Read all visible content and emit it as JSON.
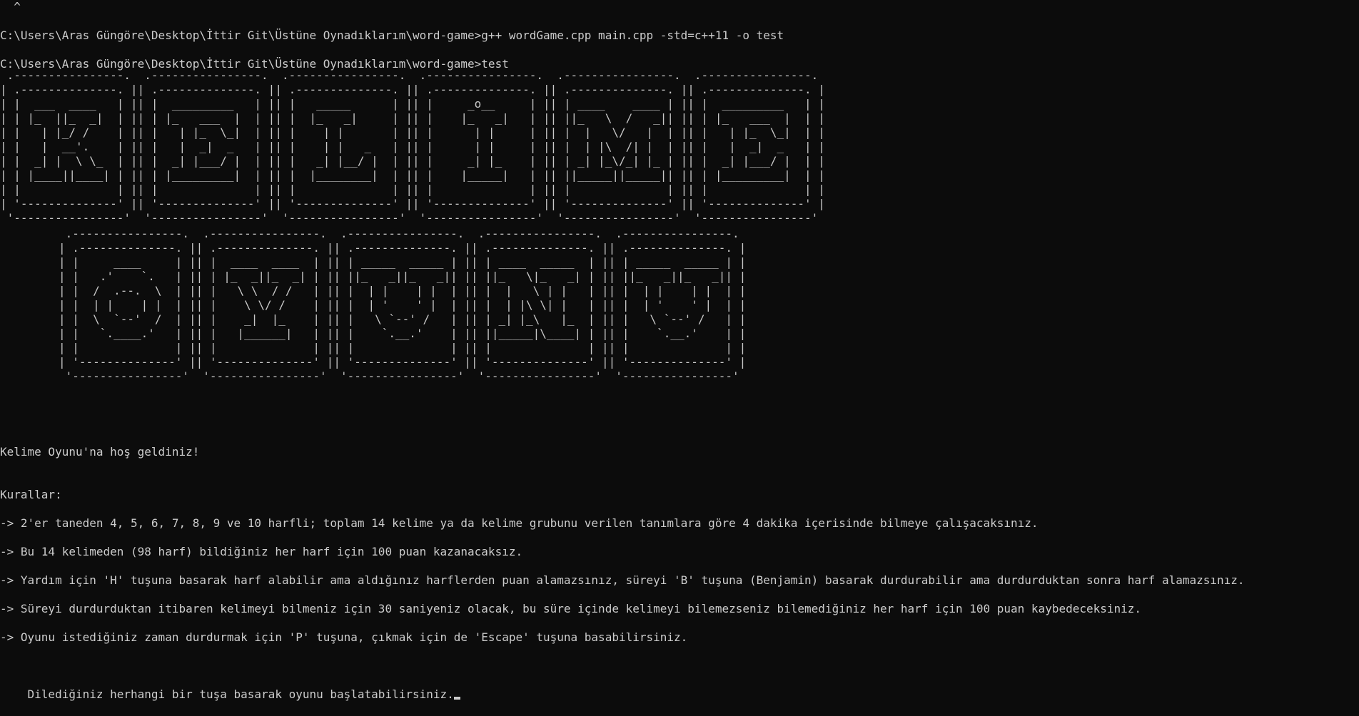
{
  "terminal": {
    "caret_line": "  ^",
    "commands": [
      "C:\\Users\\Aras Güngöre\\Desktop\\İttir Git\\Üstüne Oynadıklarım\\word-game>g++ wordGame.cpp main.cpp -std=c++11 -o test",
      "C:\\Users\\Aras Güngöre\\Desktop\\İttir Git\\Üstüne Oynadıklarım\\word-game>test"
    ],
    "banner_kelime": " .----------------.  .----------------.  .----------------.  .----------------.  .----------------.  .----------------.\n| .--------------. || .--------------. || .--------------. || .--------------. || .--------------. || .--------------. |\n| |  ___  ____   | || |  _________   | || |   _____      | || |     _o__     | || | ____    ____ | || |  _________   | |\n| | |_  ||_  _|  | || | |_   ___  |  | || |  |_   _|     | || |    |_   _|   | || ||_   \\  /   _|| || | |_   ___  |  | |\n| |   | |_/ /    | || |   | |_  \\_|  | || |    | |       | || |      | |     | || |  |   \\/   |  | || |   | |_  \\_|  | |\n| |   |  __'.    | || |   |  _|  _   | || |    | |   _   | || |      | |     | || |  | |\\  /| |  | || |   |  _|  _   | |\n| |  _| |  \\ \\_  | || |  _| |___/ |  | || |   _| |__/ |  | || |     _| |_    | || | _| |_\\/_| |_ | || |  _| |___/ |  | |\n| | |____||____| | || | |_________|  | || |  |________|  | || |    |_____|   | || ||_____||_____|| || | |_________|  | |\n| |              | || |              | || |              | || |              | || |              | || |              | |\n| '--------------' || '--------------' || '--------------' || '--------------' || '--------------' || '--------------' |\n '----------------'  '----------------'  '----------------'  '----------------'  '----------------'  '----------------'",
    "banner_oyunu": " .----------------.  .----------------.  .----------------.  .----------------.  .----------------.\n| .--------------. || .--------------. || .--------------. || .--------------. || .--------------. |\n| |     ____     | || |  ____  ____  | || | _____  _____ | || | ____  _____  | || | _____  _____ | |\n| |   .'    `.   | || | |_  _||_  _| | || ||_   _||_   _|| || ||_   \\|_   _| | || ||_   _||_   _|| |\n| |  /  .--.  \\  | || |   \\ \\  / /   | || |  | |    | |  | || |  |   \\ | |   | || |  | |    | |  | |\n| |  | |    | |  | || |    \\ \\/ /    | || |  | '    ' |  | || |  | |\\ \\| |   | || |  | '    ' |  | |\n| |  \\  `--'  /  | || |    _|  |_    | || |   \\ `--' /   | || | _| |_\\   |_  | || |   \\ `--' /   | |\n| |   `.____.'   | || |   |______|   | || |    `.__.'    | || ||_____|\\____| | || |    `.__.'    | |\n| |              | || |              | || |              | || |              | || |              | |\n| '--------------' || '--------------' || '--------------' || '--------------' || '--------------' |\n '----------------'  '----------------'  '----------------'  '----------------'  '----------------'",
    "welcome": "Kelime Oyunu'na hoş geldiniz!",
    "rules_heading": "Kurallar:",
    "rules": [
      "-> 2'er taneden 4, 5, 6, 7, 8, 9 ve 10 harfli; toplam 14 kelime ya da kelime grubunu verilen tanımlara göre 4 dakika içerisinde bilmeye çalışacaksınız.",
      "-> Bu 14 kelimeden (98 harf) bildiğiniz her harf için 100 puan kazanacaksız.",
      "-> Yardım için 'H' tuşuna basarak harf alabilir ama aldığınız harflerden puan alamazsınız, süreyi 'B' tuşuna (Benjamin) basarak durdurabilir ama durdurduktan sonra harf alamazsınız.",
      "-> Süreyi durdurduktan itibaren kelimeyi bilmeniz için 30 saniyeniz olacak, bu süre içinde kelimeyi bilemezseniz bilemediğiniz her harf için 100 puan kaybedeceksiniz.",
      "-> Oyunu istediğiniz zaman durdurmak için 'P' tuşuna, çıkmak için de 'Escape' tuşuna basabilirsiniz."
    ],
    "prompt": "Dilediğiniz herhangi bir tuşa basarak oyunu başlatabilirsiniz."
  }
}
